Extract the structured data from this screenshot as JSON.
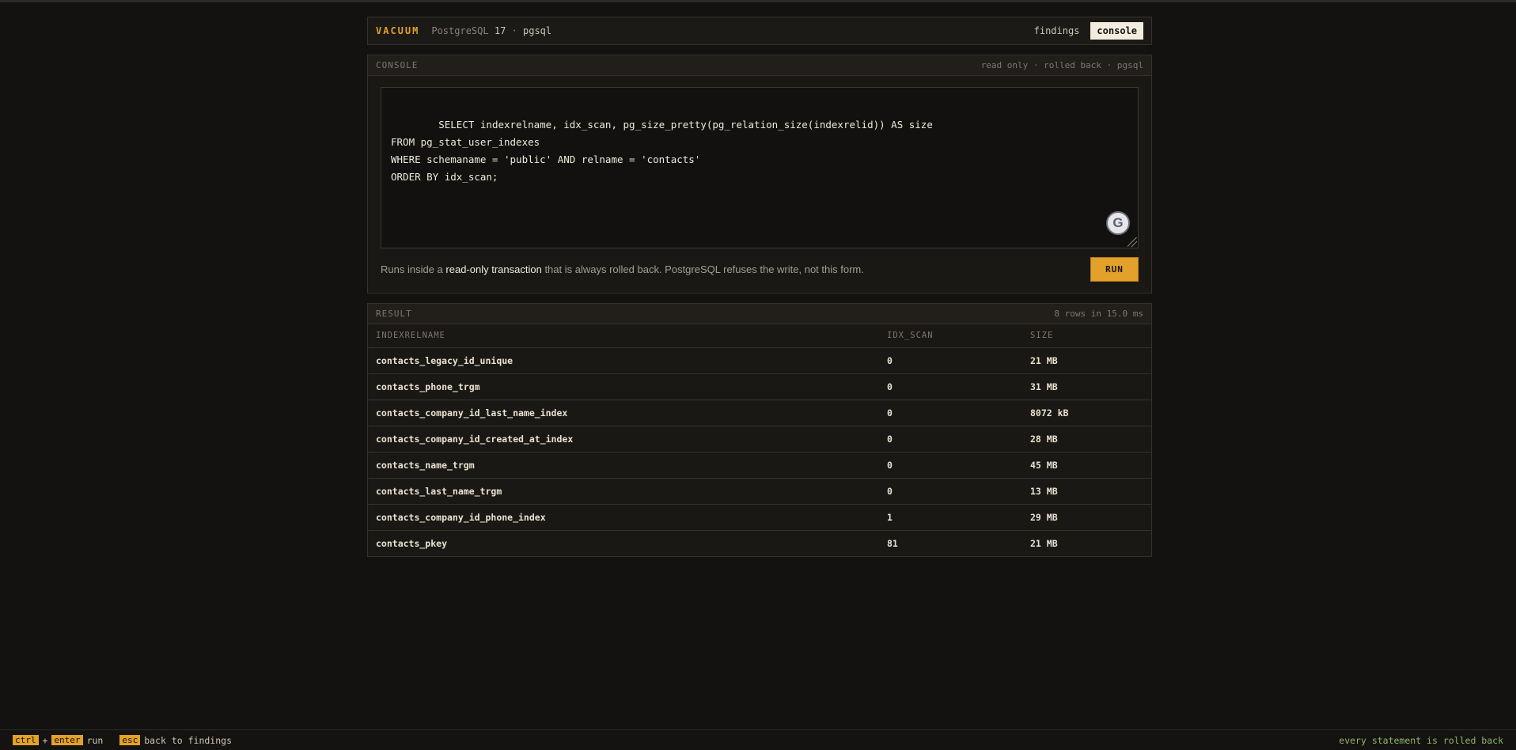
{
  "header": {
    "brand": "VACUUM",
    "subtitle_prefix": "PostgreSQL",
    "version": "17",
    "separator": "·",
    "dialect": "pgsql",
    "nav": [
      {
        "label": "findings",
        "active": false
      },
      {
        "label": "console",
        "active": true
      }
    ]
  },
  "console": {
    "title": "CONSOLE",
    "meta": "read only · rolled back · pgsql",
    "query": "SELECT indexrelname, idx_scan, pg_size_pretty(pg_relation_size(indexrelid)) AS size\nFROM pg_stat_user_indexes\nWHERE schemaname = 'public' AND relname = 'contacts'\nORDER BY idx_scan;",
    "note_prefix": "Runs inside a",
    "note_highlight": "read-only transaction",
    "note_suffix": "that is always rolled back. PostgreSQL refuses the write, not this form.",
    "run_label": "RUN",
    "grammarly_letter": "G"
  },
  "result": {
    "title": "RESULT",
    "meta": "8 rows in 15.0 ms",
    "columns": [
      "INDEXRELNAME",
      "IDX_SCAN",
      "SIZE"
    ],
    "rows": [
      [
        "contacts_legacy_id_unique",
        "0",
        "21 MB"
      ],
      [
        "contacts_phone_trgm",
        "0",
        "31 MB"
      ],
      [
        "contacts_company_id_last_name_index",
        "0",
        "8072 kB"
      ],
      [
        "contacts_company_id_created_at_index",
        "0",
        "28 MB"
      ],
      [
        "contacts_name_trgm",
        "0",
        "45 MB"
      ],
      [
        "contacts_last_name_trgm",
        "0",
        "13 MB"
      ],
      [
        "contacts_company_id_phone_index",
        "1",
        "29 MB"
      ],
      [
        "contacts_pkey",
        "81",
        "21 MB"
      ]
    ]
  },
  "footer": {
    "key_ctrl": "ctrl",
    "plus": "+",
    "key_enter": "enter",
    "run_text": "run",
    "key_esc": "esc",
    "back_text": "back to findings",
    "right_text": "every statement is rolled back"
  },
  "colors": {
    "accent": "#e3a02a",
    "background": "#141210",
    "status_green": "#8fb86a"
  }
}
